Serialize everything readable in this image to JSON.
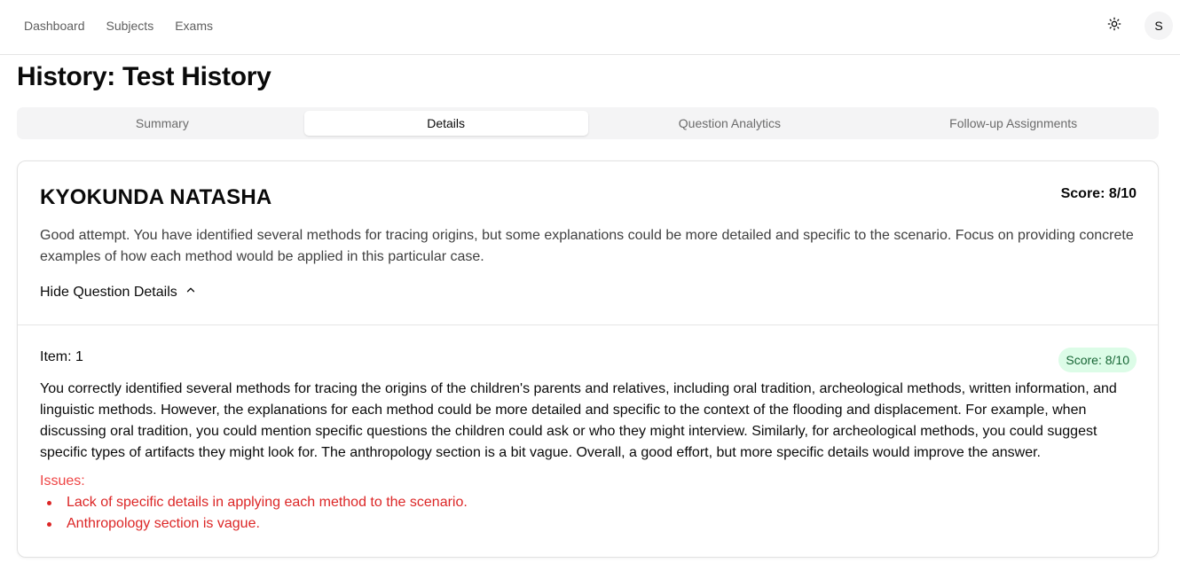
{
  "nav": {
    "items": [
      "Dashboard",
      "Subjects",
      "Exams"
    ],
    "avatar_initial": "S",
    "theme_icon": "sun-icon"
  },
  "page": {
    "title": "History: Test History"
  },
  "tabs": [
    {
      "label": "Summary",
      "active": false
    },
    {
      "label": "Details",
      "active": true
    },
    {
      "label": "Question Analytics",
      "active": false
    },
    {
      "label": "Follow-up Assignments",
      "active": false
    }
  ],
  "student": {
    "name": "KYOKUNDA NATASHA",
    "score_label": "Score: 8/10",
    "feedback": "Good attempt. You have identified several methods for tracing origins, but some explanations could be more detailed and specific to the scenario. Focus on providing concrete examples of how each method would be applied in this particular case.",
    "toggle_label": "Hide Question Details",
    "toggle_icon": "chevron-up-icon"
  },
  "item": {
    "label": "Item: 1",
    "score_label": "Score: 8/10",
    "feedback": "You correctly identified several methods for tracing the origins of the children's parents and relatives, including oral tradition, archeological methods, written information, and linguistic methods. However, the explanations for each method could be more detailed and specific to the context of the flooding and displacement. For example, when discussing oral tradition, you could mention specific questions the children could ask or who they might interview. Similarly, for archeological methods, you could suggest specific types of artifacts they might look for. The anthropology section is a bit vague. Overall, a good effort, but more specific details would improve the answer.",
    "issues_title": "Issues:",
    "issues": [
      "Lack of specific details in applying each method to the scenario.",
      "Anthropology section is vague."
    ]
  },
  "colors": {
    "score_badge_bg": "#dcfce7",
    "score_badge_text": "#166534",
    "issues": "#dc2626"
  }
}
